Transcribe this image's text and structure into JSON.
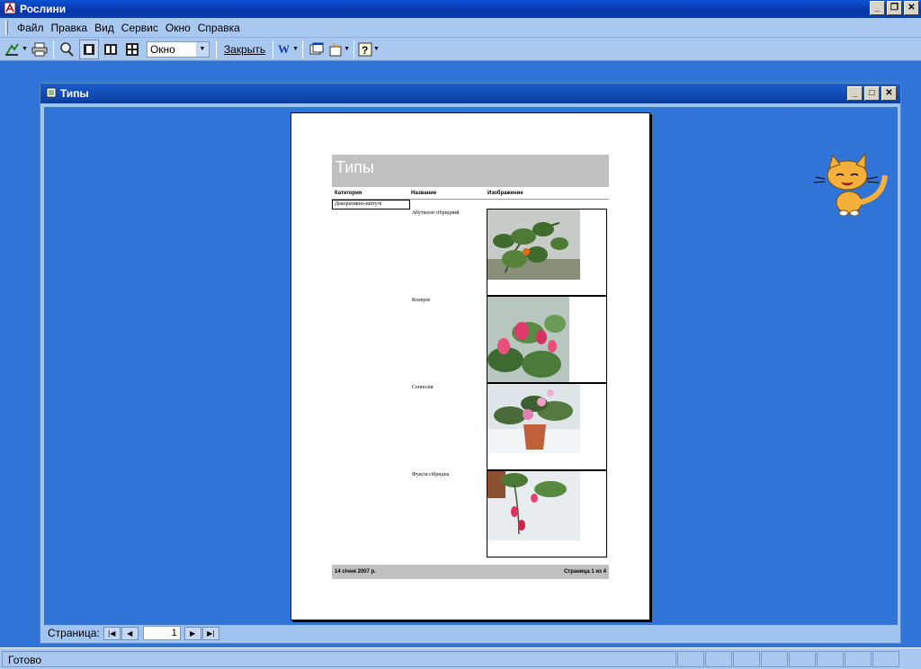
{
  "app": {
    "title": "Рослини"
  },
  "menu": {
    "items": [
      {
        "label": "Файл"
      },
      {
        "label": "Правка"
      },
      {
        "label": "Вид"
      },
      {
        "label": "Сервис"
      },
      {
        "label": "Окно"
      },
      {
        "label": "Справка"
      }
    ]
  },
  "toolbar": {
    "zoom_value": "Окно",
    "close_label": "Закрыть"
  },
  "document": {
    "title": "Типы",
    "report": {
      "header_title": "Типы",
      "columns": {
        "category": "Категория",
        "name": "Название",
        "image": "Изображение"
      },
      "category_value": "Декоративно-квітучі",
      "rows": [
        {
          "name": "Абутилон гібридний"
        },
        {
          "name": "Колерія"
        },
        {
          "name": "Сенполія"
        },
        {
          "name": "Фуксія гібридна"
        }
      ],
      "footer_date": "14 січня 2007 р.",
      "footer_page": "Страница 1 из 4"
    },
    "navigation": {
      "label": "Страница:",
      "current_page": "1"
    }
  },
  "status": {
    "text": "Готово"
  }
}
